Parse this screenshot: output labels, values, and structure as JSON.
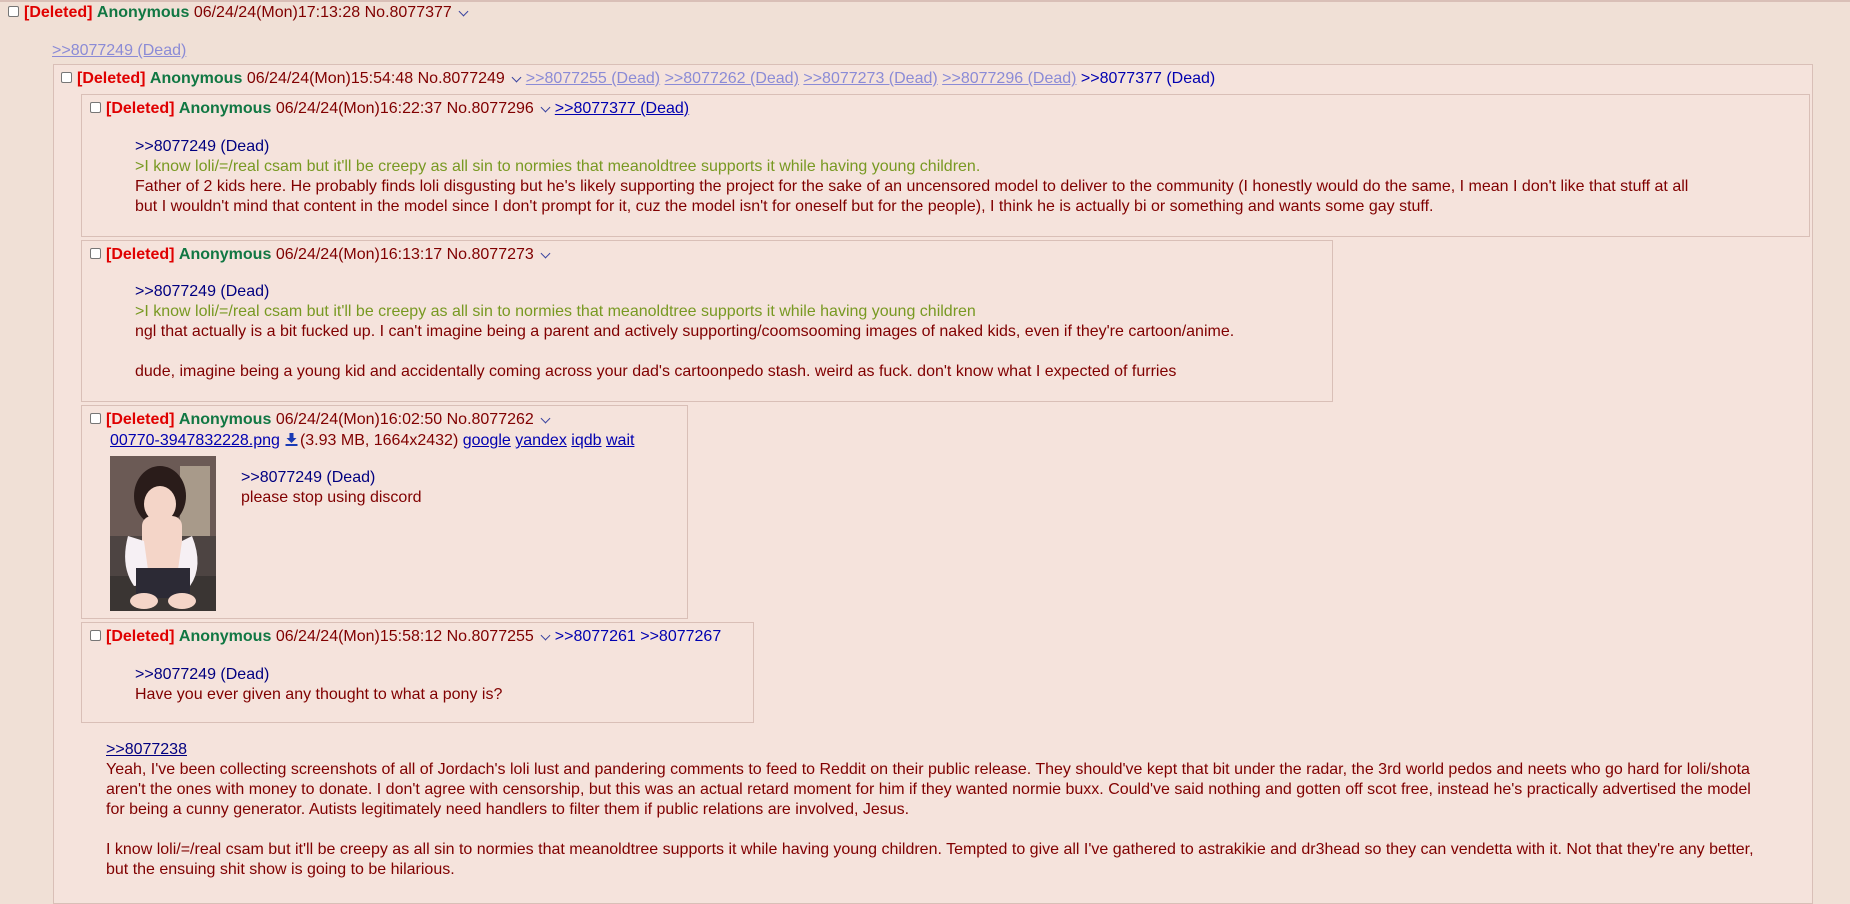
{
  "top_post": {
    "deleted": "[Deleted]",
    "name": "Anonymous",
    "date": "06/24/24(Mon)17:13:28",
    "num": "No.8077377",
    "quote": ">>8077249 (Dead)"
  },
  "p249": {
    "deleted": "[Deleted]",
    "name": "Anonymous",
    "date": "06/24/24(Mon)15:54:48",
    "num": "No.8077249",
    "backlinks": [
      ">>8077255 (Dead)",
      ">>8077262 (Dead)",
      ">>8077273 (Dead)",
      ">>8077296 (Dead)",
      ">>8077377 (Dead)"
    ]
  },
  "p296": {
    "deleted": "[Deleted]",
    "name": "Anonymous",
    "date": "06/24/24(Mon)16:22:37",
    "num": "No.8077296",
    "backlink": ">>8077377 (Dead)",
    "quote": ">>8077249 (Dead)",
    "greentext": ">I know loli/=/real csam but it'll be creepy as all sin to normies that meanoldtree supports it while having young children.",
    "body1": "Father of 2 kids here. He probably finds loli disgusting but he's likely supporting the project for the sake of an uncensored model to deliver to the community (I honestly would do the same, I mean I don't like that stuff at all",
    "body2": "but I wouldn't mind that content in the model since I don't prompt for it, cuz the model isn't for oneself but for the people), I think he is actually bi or something and wants some gay stuff."
  },
  "p273": {
    "deleted": "[Deleted]",
    "name": "Anonymous",
    "date": "06/24/24(Mon)16:13:17",
    "num": "No.8077273",
    "quote": ">>8077249 (Dead)",
    "greentext": ">I know loli/=/real csam but it'll be creepy as all sin to normies that meanoldtree supports it while having young children",
    "body1": "ngl that actually is a bit fucked up. I can't imagine being a parent and actively supporting/coomsooming images of naked kids, even if they're cartoon/anime.",
    "body2": "dude, imagine being a young kid and accidentally coming across your dad's cartoonpedo stash. weird as fuck. don't know what I expected of furries"
  },
  "p262": {
    "deleted": "[Deleted]",
    "name": "Anonymous",
    "date": "06/24/24(Mon)16:02:50",
    "num": "No.8077262",
    "filename": "00770-3947832228.png",
    "fileinfo": "(3.93 MB, 1664x2432)",
    "search": [
      "google",
      "yandex",
      "iqdb",
      "wait"
    ],
    "quote": ">>8077249 (Dead)",
    "body": "please stop using discord",
    "thumbnail_icon": "image-thumbnail"
  },
  "p255": {
    "deleted": "[Deleted]",
    "name": "Anonymous",
    "date": "06/24/24(Mon)15:58:12",
    "num": "No.8077255",
    "backlinks": [
      ">>8077261",
      ">>8077267"
    ],
    "quote": ">>8077249 (Dead)",
    "body": "Have you ever given any thought to what a pony is?"
  },
  "p249_body": {
    "quote": ">>8077238",
    "para1": "Yeah, I've been collecting screenshots of all of Jordach's loli lust and pandering comments to feed to Reddit on their public release. They should've kept that bit under the radar, the 3rd world pedos and neets who go hard for loli/shota aren't the ones with money to donate. I don't agree with censorship, but this was an actual retard moment for him if they wanted normie buxx. Could've said nothing and gotten off scot free, instead he's practically advertised the model for being a cunny generator. Autists legitimately need handlers to filter them if public relations are involved, Jesus.",
    "para2": "I know loli/=/real csam but it'll be creepy as all sin to normies that meanoldtree supports it while having young children. Tempted to give all I've gathered to astrakikie and dr3head so they can vendetta with it. Not that they're any better, but the ensuing shit show is going to be hilarious."
  },
  "colors": {
    "background": "#f0e0d6",
    "post_bg": "#f5e3dc",
    "deleted": "#e00000",
    "name": "#117743",
    "greentext": "#789922",
    "quotelink": "#000080",
    "dead_link": "#8b8bd6"
  }
}
